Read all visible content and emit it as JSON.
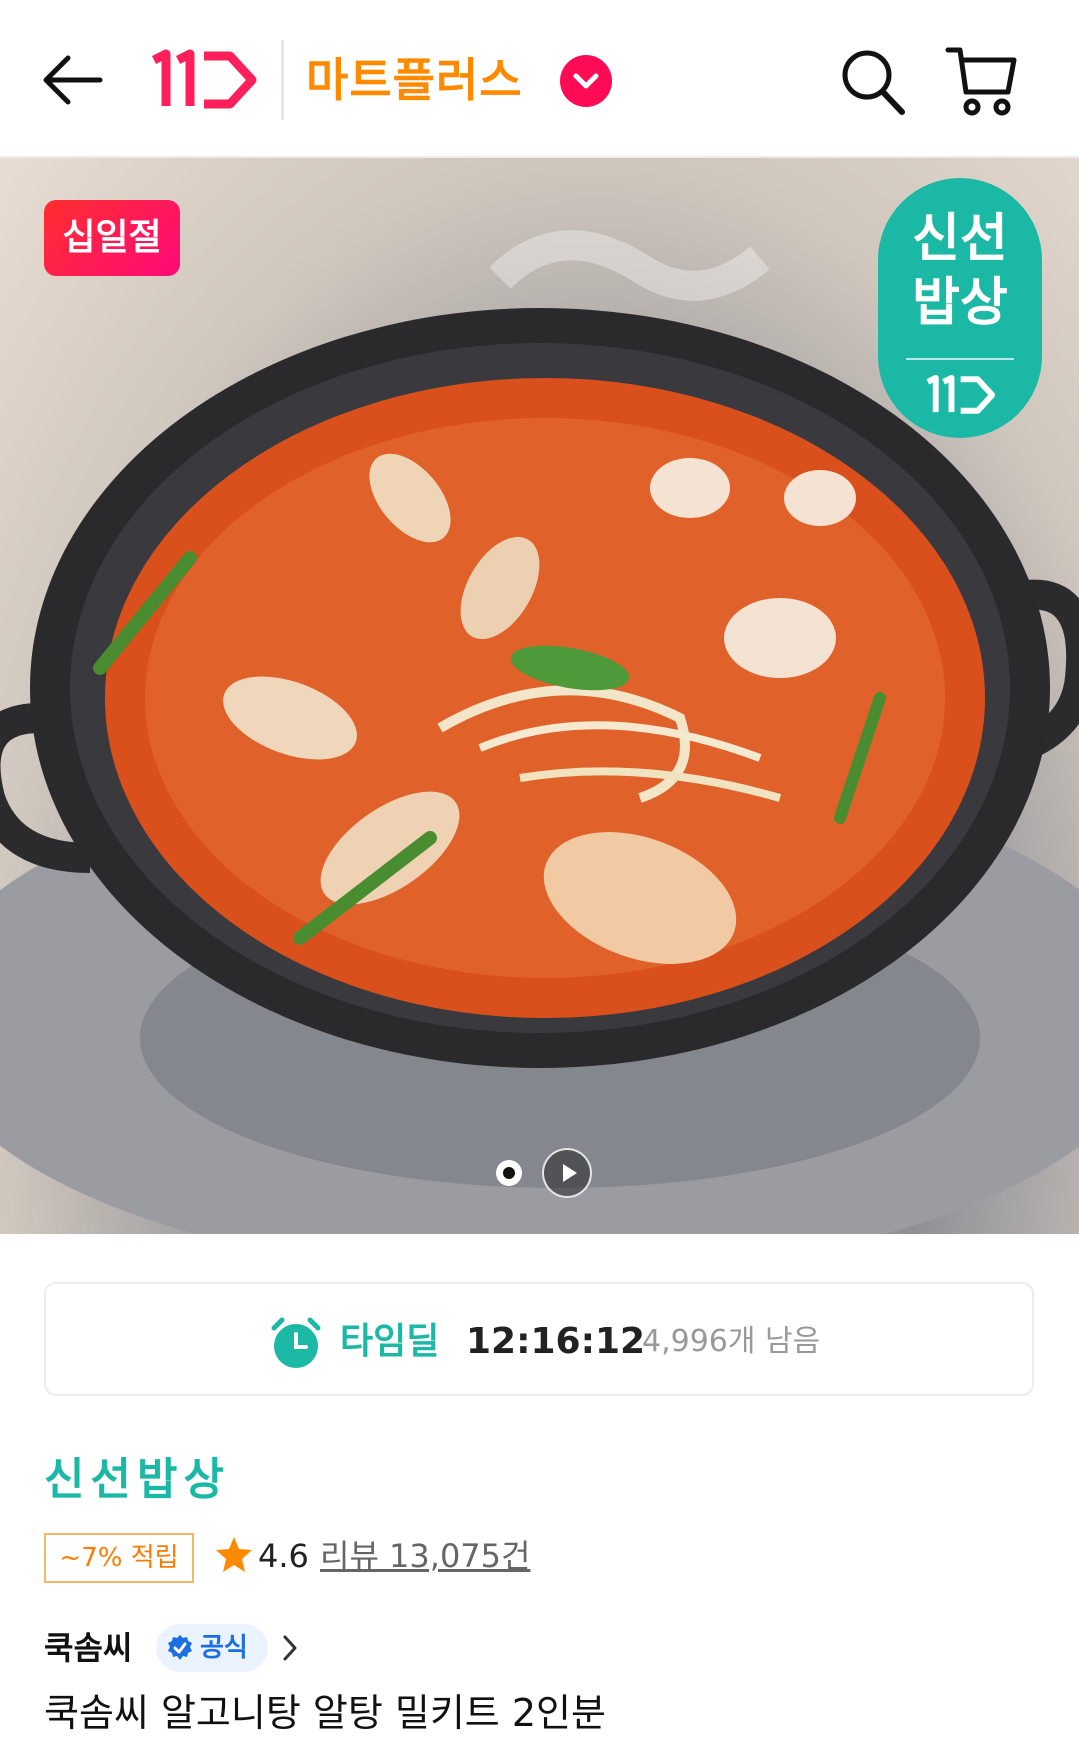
{
  "header": {
    "back_icon": "arrow-left-icon",
    "logo_text": "11",
    "brand_name": "마트플러스",
    "brand_color": "#ff8a00",
    "brand_check_color": "#ff0a54",
    "search_icon": "search-icon",
    "cart_icon": "cart-icon"
  },
  "hero": {
    "badge_left": "십일절",
    "badge_right_line1": "신선",
    "badge_right_line2": "밥상",
    "badge_right_logo": "11",
    "badge_right_color": "#1cb8a6",
    "pager_play_icon": "play-icon"
  },
  "timedeal": {
    "icon": "alarm-clock-icon",
    "label": "타임딜",
    "time": "12:16:12",
    "remaining": "4,996개 남음",
    "accent": "#1cb8a6"
  },
  "product": {
    "brand": "신선밥상",
    "points": "~7% 적립",
    "rating": "4.6",
    "reviews": "리뷰 13,075건",
    "shop_name": "쿡솜씨",
    "official_label": "공식",
    "title": "쿡솜씨 알고니탕 알탕 밀키트 2인분"
  }
}
